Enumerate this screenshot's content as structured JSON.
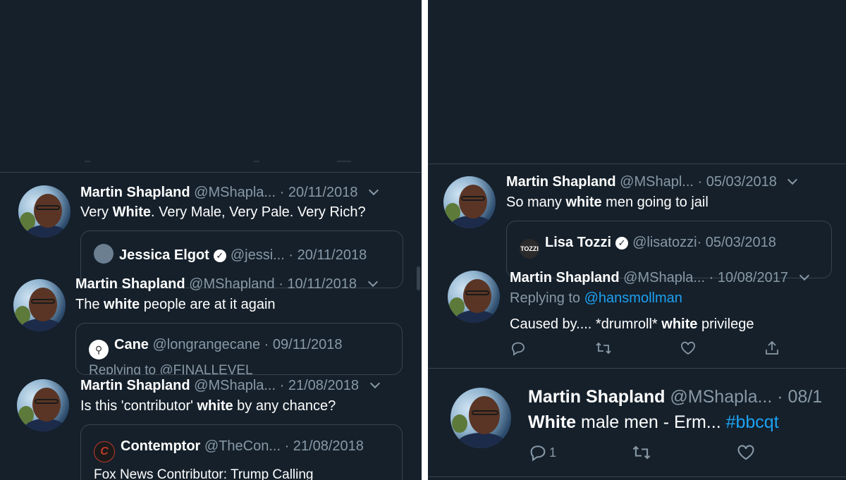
{
  "left": {
    "tweets": [
      {
        "name": "Martin Shapland",
        "handle": "@MShapla...",
        "date": "· 20/11/2018",
        "text_parts": [
          "Very ",
          "White",
          ". Very Male, Very Pale. Very Rich?"
        ],
        "quote": {
          "name": "Jessica Elgot",
          "handle": "@jessi...",
          "date": "· 20/11/2018",
          "text": ""
        }
      },
      {
        "name": "Martin Shapland",
        "handle": "@MShapland",
        "date": "· 10/11/2018",
        "text_parts": [
          "The ",
          "white",
          " people are at it again"
        ],
        "quote": {
          "name": "Cane",
          "handle": "@longrangecane",
          "date": "· 09/11/2018",
          "text": "Replying to @FINALLEVEL"
        }
      },
      {
        "name": "Martin Shapland",
        "handle": "@MShapla...",
        "date": "· 21/08/2018",
        "text_parts": [
          "Is this 'contributor' ",
          "white",
          " by any chance?"
        ],
        "quote": {
          "name": "Contemptor",
          "handle": "@TheCon...",
          "date": "· 21/08/2018",
          "text": "Fox News Contributor: Trump Calling"
        }
      }
    ]
  },
  "right": {
    "tweets": [
      {
        "name": "Martin Shapland",
        "handle": "@MShapl...",
        "date": "· 05/03/2018",
        "text_parts": [
          "So many ",
          "white",
          " men going to jail"
        ],
        "quote": {
          "avatar_text": "TOZZI",
          "name": "Lisa Tozzi",
          "handle": "@lisatozzi",
          "date": "· 05/03/2018"
        }
      },
      {
        "name": "Martin Shapland",
        "handle": "@MShapla...",
        "date": "· 10/08/2017",
        "replying_label": "Replying to",
        "replying_handle": "@hansmollman",
        "text_parts": [
          "Caused by.... *drumroll* ",
          "white",
          " privilege"
        ]
      },
      {
        "name": "Martin Shapland",
        "handle": "@MShapla...",
        "date": "· 08/1",
        "text_bold": "White",
        "text_rest": " male men - Erm... ",
        "hashtag": "#bbcqt",
        "reply_count": "1"
      }
    ]
  },
  "colors": {
    "background": "#15202b",
    "border": "#38444d",
    "muted": "#8899a6",
    "link": "#1da1f2"
  }
}
